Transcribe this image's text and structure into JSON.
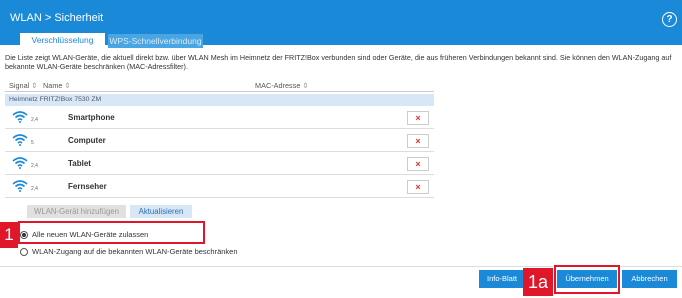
{
  "header": {
    "breadcrumb": "WLAN > Sicherheit",
    "help_label": "?"
  },
  "tabs": [
    {
      "label": "Verschlüsselung",
      "active": true
    },
    {
      "label": "WPS-Schnellverbindung",
      "active": false
    }
  ],
  "description": "Die Liste zeigt WLAN-Geräte, die aktuell direkt bzw. über WLAN Mesh im Heimnetz der FRITZ!Box verbunden sind oder Geräte, die aus früheren Verbindungen bekannt sind. Sie können den WLAN-Zugang auf bekannte WLAN-Geräte beschränken (MAC-Adressfilter).",
  "table": {
    "columns": [
      "Signal",
      "Name",
      "MAC-Adresse"
    ],
    "group_label": "Heimnetz FRITZ!Box 7530 ZM",
    "rows": [
      {
        "name": "Smartphone",
        "band": "2,4"
      },
      {
        "name": "Computer",
        "band": "5"
      },
      {
        "name": "Tablet",
        "band": "2,4"
      },
      {
        "name": "Fernseher",
        "band": "2,4"
      }
    ],
    "delete_label": "×"
  },
  "actions": {
    "add_label": "WLAN-Gerät hinzufügen",
    "update_label": "Aktualisieren"
  },
  "radio_options": [
    {
      "label": "Alle neuen WLAN-Geräte zulassen",
      "checked": true
    },
    {
      "label": "WLAN-Zugang auf die bekannten WLAN-Geräte beschränken",
      "checked": false
    }
  ],
  "footer": {
    "info_label": "Info-Blatt",
    "apply_label": "Übernehmen",
    "cancel_label": "Abbrechen"
  },
  "callouts": {
    "c1": "1",
    "c2": "1a"
  },
  "colors": {
    "accent": "#1a8ad8",
    "highlight": "#e0162b"
  }
}
